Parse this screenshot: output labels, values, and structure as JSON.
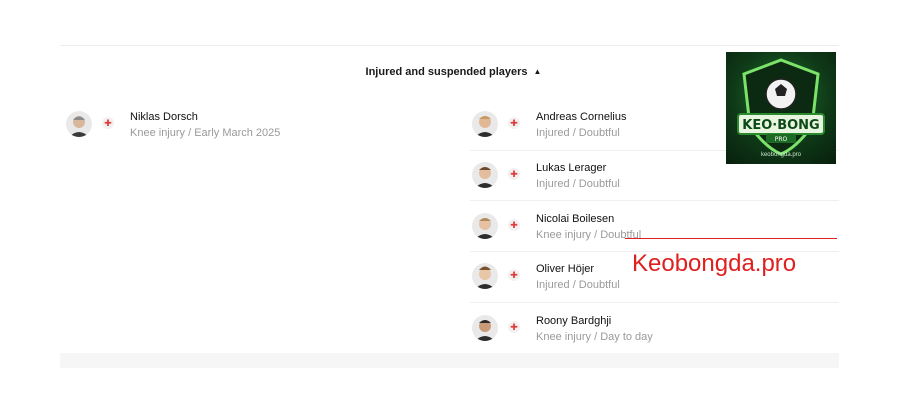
{
  "section": {
    "title": "Injured and suspended players",
    "toggle_icon": "caret-up-icon"
  },
  "home": [
    {
      "name": "Niklas Dorsch",
      "status": "Knee injury / Early March 2025",
      "avatar_icon": "player-avatar-icon",
      "injury_icon": "injury-cross-icon"
    }
  ],
  "away": [
    {
      "name": "Andreas Cornelius",
      "status": "Injured / Doubtful",
      "avatar_icon": "player-avatar-icon",
      "injury_icon": "injury-cross-icon"
    },
    {
      "name": "Lukas Lerager",
      "status": "Injured / Doubtful",
      "avatar_icon": "player-avatar-icon",
      "injury_icon": "injury-cross-icon"
    },
    {
      "name": "Nicolai Boilesen",
      "status": "Knee injury / Doubtful",
      "avatar_icon": "player-avatar-icon",
      "injury_icon": "injury-cross-icon"
    },
    {
      "name": "Oliver Höjer",
      "status": "Injured / Doubtful",
      "avatar_icon": "player-avatar-icon",
      "injury_icon": "injury-cross-icon"
    },
    {
      "name": "Roony Bardghji",
      "status": "Knee injury / Day to day",
      "avatar_icon": "player-avatar-icon",
      "injury_icon": "injury-cross-icon"
    }
  ],
  "watermark": {
    "text": "Keobongda.pro",
    "logo_text": "KEO BONG",
    "logo_sub": "PRO",
    "logo_caption": "keobongda.pro",
    "color": "#e02020"
  },
  "colors": {
    "injury": "#e23a3a",
    "muted_text": "#9a9a9a"
  }
}
